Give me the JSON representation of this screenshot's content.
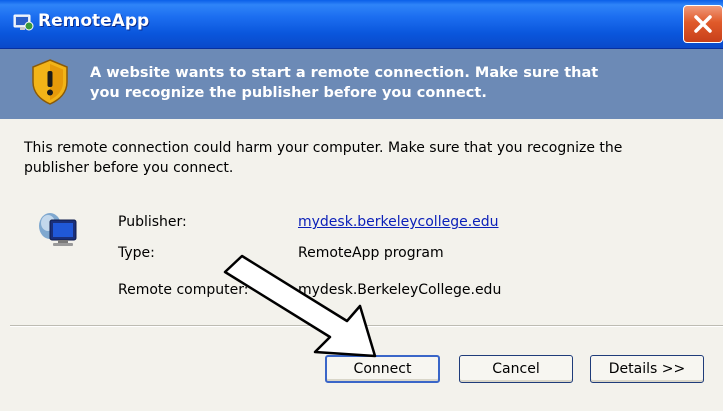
{
  "window": {
    "title": "RemoteApp"
  },
  "banner": {
    "line1": "A website wants to start a remote connection. Make sure that",
    "line2": "you recognize the publisher before you connect."
  },
  "body": {
    "line1": "This remote connection could harm your computer. Make sure that you recognize the",
    "line2": "publisher before you connect."
  },
  "details": {
    "publisher": {
      "label": "Publisher:",
      "value": "mydesk.berkeleycollege.edu"
    },
    "type": {
      "label": "Type:",
      "value": "RemoteApp program"
    },
    "remote_computer": {
      "label": "Remote computer:",
      "value": "mydesk.BerkeleyCollege.edu"
    }
  },
  "buttons": {
    "connect": "Connect",
    "cancel": "Cancel",
    "details": "Details >>"
  },
  "icons": {
    "app": "remoteapp-icon",
    "close": "close-icon",
    "warning": "shield-warning-icon",
    "computer": "computer-icon",
    "annotation": "arrow-pointer"
  },
  "colors": {
    "titlebar": "#0a56dc",
    "banner": "#6c8ab6",
    "link": "#0a1fb8",
    "close_button": "#e05a2a"
  }
}
